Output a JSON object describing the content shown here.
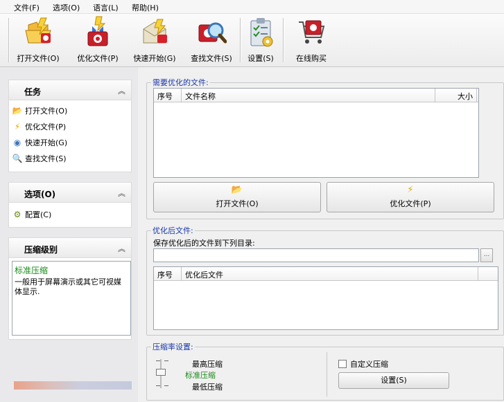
{
  "menu": {
    "file": "文件(F)",
    "options": "选项(O)",
    "language": "语言(L)",
    "help": "帮助(H)"
  },
  "toolbar": {
    "open": "打开文件(O)",
    "optimize": "优化文件(P)",
    "quickstart": "快速开始(G)",
    "find": "查找文件(S)",
    "settings": "设置(S)",
    "buy": "在线购买"
  },
  "tasks": {
    "title": "任务",
    "items": [
      "打开文件(O)",
      "优化文件(P)",
      "快速开始(G)",
      "查找文件(S)"
    ]
  },
  "options_group": {
    "title": "选项(O)",
    "items": [
      "配置(C)"
    ]
  },
  "compression_group": {
    "title": "压缩级别",
    "level_name": "标准压缩",
    "level_desc": "一般用于屏幕演示或其它可视媒体显示."
  },
  "files_to_optimize": {
    "legend": "需要优化的文件:",
    "columns": [
      "序号",
      "文件名称",
      "大小"
    ],
    "open_button": "打开文件(O)",
    "optimize_button": "优化文件(P)"
  },
  "optimized_files": {
    "legend": "优化后文件:",
    "save_label": "保存优化后的文件到下列目录:",
    "path_value": "",
    "browse": "...",
    "columns": [
      "序号",
      "优化后文件"
    ]
  },
  "compression_settings": {
    "legend": "压缩率设置:",
    "levels": [
      "最高压缩",
      "标准压缩",
      "最低压缩"
    ],
    "selected": "标准压缩",
    "custom_label": "自定义压缩",
    "settings_button": "设置(S)"
  },
  "colors": {
    "legend": "#1836a8",
    "selected_level": "#1a8a1a"
  }
}
